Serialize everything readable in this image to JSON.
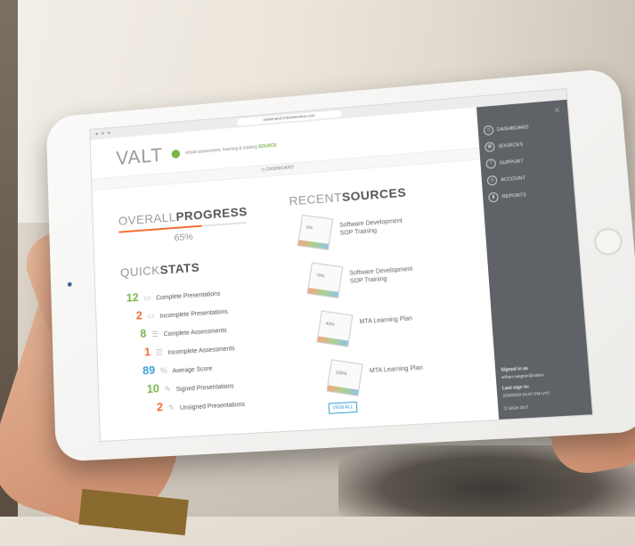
{
  "browser": {
    "url": "ondemand.richetelevirtus.com"
  },
  "header": {
    "logo": "VALT",
    "tagline": "virtual assessment, learning & training",
    "tagline_source": "SOURCE",
    "dashboard_label": "DASHBOARD"
  },
  "progress": {
    "title_light": "OVERALL",
    "title_bold": "PROGRESS",
    "percent_value": 65,
    "percent_text": "65%"
  },
  "quickstats": {
    "title_light": "QUICK",
    "title_bold": "STATS",
    "items": [
      {
        "value": "12",
        "label": "Complete Presentations",
        "icon": "monitor-icon",
        "color": "#7ab648"
      },
      {
        "value": "2",
        "label": "Incomplete Presentations",
        "icon": "monitor-icon",
        "color": "#f26b2f"
      },
      {
        "value": "8",
        "label": "Complete Assessments",
        "icon": "list-icon",
        "color": "#7ab648"
      },
      {
        "value": "1",
        "label": "Incomplete Assessments",
        "icon": "list-icon",
        "color": "#f26b2f"
      },
      {
        "value": "89",
        "label": "Average Score",
        "icon": "percent-icon",
        "color": "#3aa0d8"
      },
      {
        "value": "10",
        "label": "Signed Presentations",
        "icon": "pen-icon",
        "color": "#7ab648"
      },
      {
        "value": "2",
        "label": "Unsigned Presentations",
        "icon": "pen-icon",
        "color": "#f26b2f"
      }
    ]
  },
  "recent_sources": {
    "title_light": "RECENT",
    "title_bold": "SOURCES",
    "items": [
      {
        "percent": "0%",
        "line1": "Software Development",
        "line2": "SOP Training"
      },
      {
        "percent": "75%",
        "line1": "Software Development",
        "line2": "SOP Training"
      },
      {
        "percent": "45%",
        "line1": "MTA Learning Plan",
        "line2": ""
      },
      {
        "percent": "100%",
        "line1": "MTA Learning Plan",
        "line2": ""
      }
    ],
    "view_all_label": "VIEW ALL"
  },
  "sidebar": {
    "close": "×",
    "items": [
      {
        "label": "DASHBOARD",
        "icon": "clock-icon"
      },
      {
        "label": "SOURCES",
        "icon": "grid-icon"
      },
      {
        "label": "SUPPORT",
        "icon": "help-icon"
      },
      {
        "label": "ACCOUNT",
        "icon": "fingerprint-icon"
      },
      {
        "label": "REPORTS",
        "icon": "bar-chart-icon"
      }
    ],
    "signed_in_as_label": "Signed in as",
    "signed_in_email": "william.wagner@valtvu",
    "last_sign_in_label": "Last sign in:",
    "last_sign_in_value": "2/26/2018 04:07 PM UTC",
    "sign_out_label": "SIGN OUT"
  }
}
